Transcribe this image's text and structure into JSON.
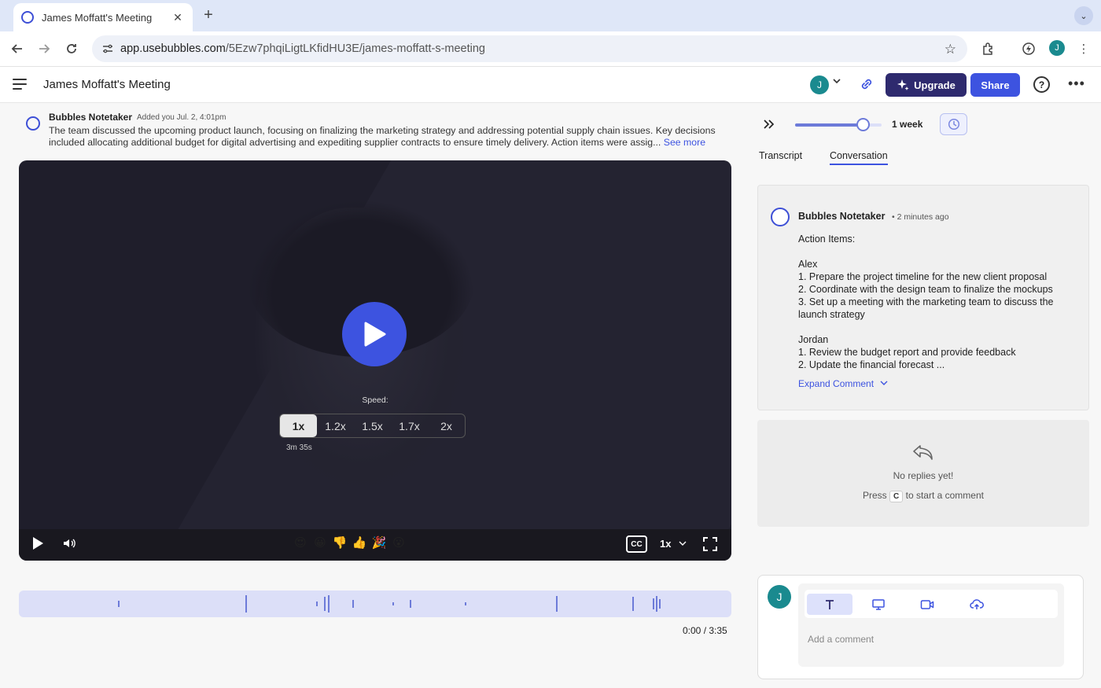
{
  "browser": {
    "tab_title": "James Moffatt's Meeting",
    "tab_close": "✕",
    "new_tab": "+",
    "url_host": "app.usebubbles.com",
    "url_path": "/5Ezw7phqiLigtLKfidHU3E/james-moffatt-s-meeting",
    "profile_initial": "J"
  },
  "header": {
    "title": "James Moffatt's Meeting",
    "avatar_initial": "J",
    "upgrade_label": "Upgrade",
    "share_label": "Share",
    "help_label": "?"
  },
  "summary": {
    "author": "Bubbles Notetaker",
    "added": "Added you Jul. 2, 4:01pm",
    "text": "The team discussed the upcoming product launch, focusing on finalizing the marketing strategy and addressing potential supply chain issues. Key decisions included allocating additional budget for digital advertising and expediting supplier contracts to ensure timely delivery. Action items were assig...",
    "see_more": "See more"
  },
  "video": {
    "speed_label": "Speed:",
    "speed_options": [
      "1x",
      "1.2x",
      "1.5x",
      "1.7x",
      "2x"
    ],
    "selected_speed": "1x",
    "duration_hint": "3m 35s",
    "reactions": [
      "😍",
      "😀",
      "👎",
      "👍",
      "🎉",
      "😮"
    ],
    "cc_label": "CC",
    "playback_speed": "1x"
  },
  "timeline": {
    "time": "0:00 / 3:35",
    "current": "0:00",
    "total": "3:35"
  },
  "panel": {
    "range_label": "1 week",
    "tabs": [
      "Transcript",
      "Conversation"
    ],
    "active_tab": "Conversation"
  },
  "comment": {
    "author": "Bubbles Notetaker",
    "time": "• 2 minutes ago",
    "body": "Action Items:\n\nAlex\n1. Prepare the project timeline for the new client proposal\n2. Coordinate with the design team to finalize the mockups\n3. Set up a meeting with the marketing team to discuss the launch strategy\n\nJordan\n1. Review the budget report and provide feedback\n2. Update the financial forecast ...",
    "expand_label": "Expand Comment"
  },
  "replies": {
    "empty_title": "No replies yet!",
    "hint_prefix": "Press",
    "hint_key": "C",
    "hint_suffix": "to start a comment"
  },
  "composer": {
    "avatar_initial": "J",
    "tools": [
      "text-icon",
      "screen-icon",
      "camera-icon",
      "upload-icon"
    ],
    "placeholder": "Add a comment"
  },
  "colors": {
    "brand_blue": "#3d53e0",
    "upgrade_navy": "#2e2a6e",
    "avatar_teal": "#1a8a8f"
  }
}
